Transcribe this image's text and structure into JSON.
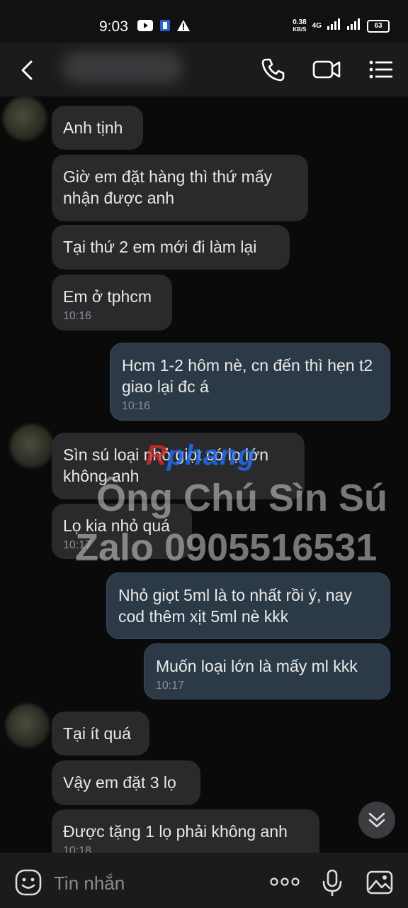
{
  "status_bar": {
    "time": "9:03",
    "net_speed_value": "0.38",
    "net_speed_unit": "KB/S",
    "network": "4G",
    "battery": "63"
  },
  "header": {
    "back_icon": "back-arrow-icon",
    "call_icon": "phone-icon",
    "video_icon": "video-camera-icon",
    "menu_icon": "list-menu-icon"
  },
  "messages": [
    {
      "side": "in",
      "text": "Anh tịnh",
      "time": ""
    },
    {
      "side": "in",
      "text": "Giờ em đặt hàng thì thứ mấy nhận được anh",
      "time": ""
    },
    {
      "side": "in",
      "text": "Tại thứ 2 em mới đi làm lại",
      "time": ""
    },
    {
      "side": "in",
      "text": "Em ở tphcm",
      "time": "10:16"
    },
    {
      "side": "out",
      "text": "Hcm 1-2 hôm nè, cn đến thì hẹn t2 giao lại đc á",
      "time": "10:16"
    },
    {
      "side": "in",
      "text": "Sìn sú loại nhỏ giọt có lọ lớn không anh",
      "time": ""
    },
    {
      "side": "in",
      "text": "Lọ kia nhỏ quá",
      "time": "10:17"
    },
    {
      "side": "out",
      "text": "Nhỏ giọt 5ml là to nhất rồi ý, nay cod thêm xịt 5ml nè kkk",
      "time": ""
    },
    {
      "side": "out",
      "text": "Muốn loại lớn là mấy ml kkk",
      "time": "10:17"
    },
    {
      "side": "in",
      "text": "Tại ít quá",
      "time": ""
    },
    {
      "side": "in",
      "text": "Vậy em đặt 3 lọ",
      "time": ""
    },
    {
      "side": "in",
      "text": "Được tặng 1 lọ phải không anh",
      "time": "10:18"
    }
  ],
  "watermark": {
    "logo_part1": "R",
    "logo_part2": "phang",
    "line1": "Ông Chú Sìn Sú",
    "line2": "Zalo 0905516531"
  },
  "input_bar": {
    "placeholder": "Tin nhắn",
    "emoji_icon": "emoji-icon",
    "more_icon": "more-dots-icon",
    "mic_icon": "microphone-icon",
    "image_icon": "image-icon"
  },
  "colors": {
    "incoming_bubble": "#2a2a2c",
    "outgoing_bubble": "#2c3a48",
    "background": "#0a0a0a"
  }
}
